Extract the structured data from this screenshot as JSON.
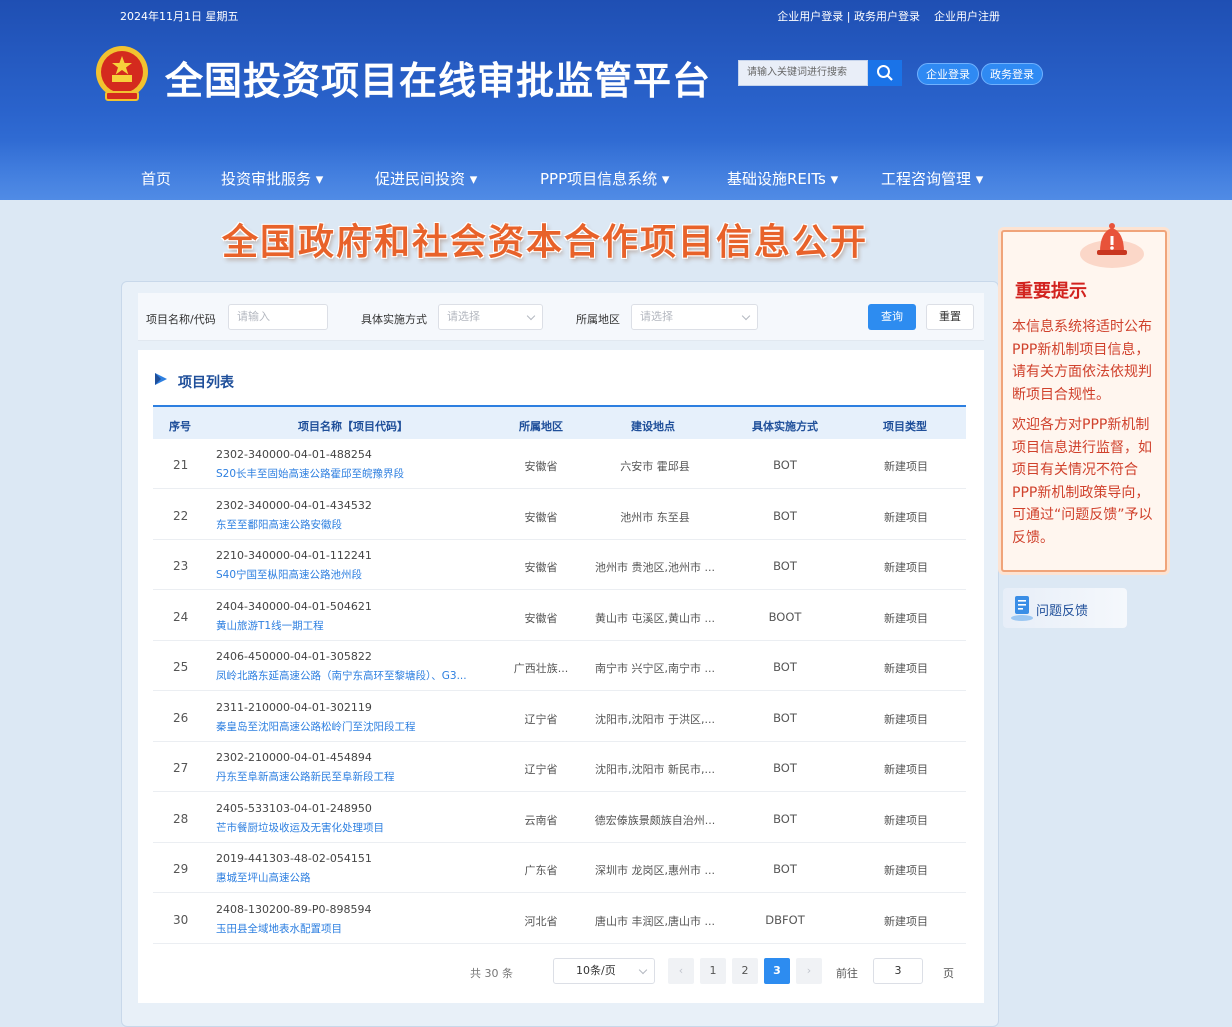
{
  "header": {
    "date": "2024年11月1日 星期五",
    "top_links": [
      "企业用户登录 | 政务用户登录",
      "企业用户注册"
    ],
    "site_title": "全国投资项目在线审批监管平台",
    "search_placeholder": "请输入关键词进行搜索",
    "login_enterprise": "企业登录",
    "login_gov": "政务登录"
  },
  "nav": {
    "items": [
      "首页",
      "投资审批服务 ▾",
      "促进民间投资 ▾",
      "PPP项目信息系统 ▾",
      "基础设施REITs ▾",
      "工程咨询管理 ▾"
    ]
  },
  "banner": {
    "text": "全国政府和社会资本合作项目信息公开"
  },
  "filters": {
    "name_label": "项目名称/代码",
    "name_placeholder": "请输入",
    "mode_label": "具体实施方式",
    "mode_placeholder": "请选择",
    "area_label": "所属地区",
    "area_placeholder": "请选择",
    "query_label": "查询",
    "reset_label": "重置"
  },
  "list": {
    "title": "项目列表",
    "columns": [
      "序号",
      "项目名称【项目代码】",
      "所属地区",
      "建设地点",
      "具体实施方式",
      "项目类型"
    ],
    "rows": [
      {
        "seq": "21",
        "code": "2302-340000-04-01-488254",
        "name": "S20长丰至固始高速公路霍邱至皖豫界段",
        "area": "安徽省",
        "site": "六安市 霍邱县",
        "mode": "BOT",
        "type": "新建项目"
      },
      {
        "seq": "22",
        "code": "2302-340000-04-01-434532",
        "name": "东至至鄱阳高速公路安徽段",
        "area": "安徽省",
        "site": "池州市 东至县",
        "mode": "BOT",
        "type": "新建项目"
      },
      {
        "seq": "23",
        "code": "2210-340000-04-01-112241",
        "name": "S40宁国至枞阳高速公路池州段",
        "area": "安徽省",
        "site": "池州市 贵池区,池州市 ...",
        "mode": "BOT",
        "type": "新建项目"
      },
      {
        "seq": "24",
        "code": "2404-340000-04-01-504621",
        "name": "黄山旅游T1线一期工程",
        "area": "安徽省",
        "site": "黄山市 屯溪区,黄山市 ...",
        "mode": "BOOT",
        "type": "新建项目"
      },
      {
        "seq": "25",
        "code": "2406-450000-04-01-305822",
        "name": "凤岭北路东延高速公路（南宁东高环至黎塘段）、G3...",
        "area": "广西壮族...",
        "site": "南宁市 兴宁区,南宁市 ...",
        "mode": "BOT",
        "type": "新建项目"
      },
      {
        "seq": "26",
        "code": "2311-210000-04-01-302119",
        "name": "秦皇岛至沈阳高速公路松岭门至沈阳段工程",
        "area": "辽宁省",
        "site": "沈阳市,沈阳市 于洪区,...",
        "mode": "BOT",
        "type": "新建项目"
      },
      {
        "seq": "27",
        "code": "2302-210000-04-01-454894",
        "name": "丹东至阜新高速公路新民至阜新段工程",
        "area": "辽宁省",
        "site": "沈阳市,沈阳市 新民市,...",
        "mode": "BOT",
        "type": "新建项目"
      },
      {
        "seq": "28",
        "code": "2405-533103-04-01-248950",
        "name": "芒市餐厨垃圾收运及无害化处理项目",
        "area": "云南省",
        "site": "德宏傣族景颇族自治州...",
        "mode": "BOT",
        "type": "新建项目"
      },
      {
        "seq": "29",
        "code": "2019-441303-48-02-054151",
        "name": "惠城至坪山高速公路",
        "area": "广东省",
        "site": "深圳市 龙岗区,惠州市 ...",
        "mode": "BOT",
        "type": "新建项目"
      },
      {
        "seq": "30",
        "code": "2408-130200-89-P0-898594",
        "name": "玉田县全域地表水配置项目",
        "area": "河北省",
        "site": "唐山市 丰润区,唐山市 ...",
        "mode": "DBFOT",
        "type": "新建项目"
      }
    ]
  },
  "pager": {
    "total": "共 30 条",
    "page_size": "10条/页",
    "pages": [
      "1",
      "2",
      "3"
    ],
    "current": "3",
    "goto_label": "前往",
    "goto_value": "3",
    "unit": "页"
  },
  "notice": {
    "title": "重要提示",
    "p1": "本信息系统将适时公布PPP新机制项目信息，请有关方面依法依规判断项目合规性。",
    "p2": "欢迎各方对PPP新机制项目信息进行监督，如项目有关情况不符合PPP新机制政策导向，可通过“问题反馈”予以反馈。",
    "feedback": "问题反馈"
  },
  "colors": {
    "accent": "#2d8cf0",
    "header": "#2a63cc",
    "notice_red": "#d2231f",
    "banner_orange": "#e8622a"
  }
}
